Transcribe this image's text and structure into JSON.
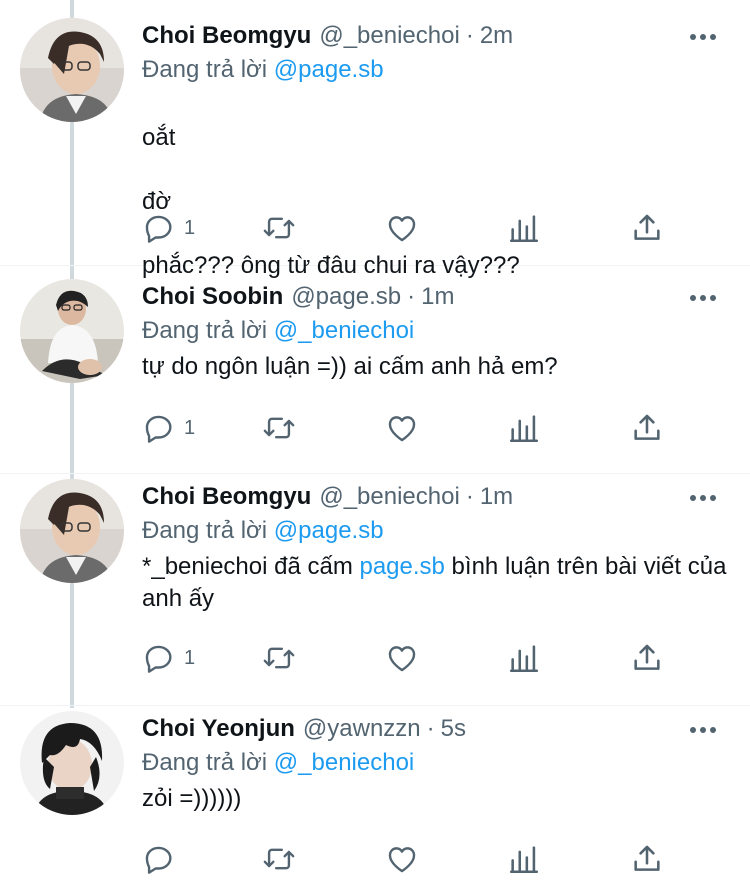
{
  "thread": {
    "reply_prefix": "Đang trả lời",
    "colors": {
      "text": "#0f1419",
      "secondary": "#536471",
      "link": "#1d9bf0",
      "thread_line": "#cfd9de"
    },
    "tweets": [
      {
        "name": "Choi Beomgyu",
        "handle": "@_beniechoi",
        "separator": "·",
        "time": "2m",
        "reply_to": "@page.sb",
        "text_lines": [
          "oắt",
          "đờ",
          "phắc??? ông từ đâu chui ra vậy???"
        ],
        "reply_count": "1",
        "avatar_icon": "avatar-photo"
      },
      {
        "name": "Choi Soobin",
        "handle": "@page.sb",
        "separator": "·",
        "time": "1m",
        "reply_to": "@_beniechoi",
        "text": "tự do ngôn luận =)) ai cấm anh hả em?",
        "reply_count": "1",
        "avatar_icon": "avatar-photo"
      },
      {
        "name": "Choi Beomgyu",
        "handle": "@_beniechoi",
        "separator": "·",
        "time": "1m",
        "reply_to": "@page.sb",
        "text_before": "*_beniechoi đã cấm ",
        "text_mention": "page.sb",
        "text_after": " bình luận trên bài viết của anh ấy",
        "reply_count": "1",
        "avatar_icon": "avatar-photo"
      },
      {
        "name": "Choi Yeonjun",
        "handle": "@yawnzzn",
        "separator": "·",
        "time": "5s",
        "reply_to": "@_beniechoi",
        "text": "zỏi =))))))",
        "reply_count": "",
        "avatar_icon": "avatar-photo"
      }
    ],
    "icons": {
      "more": "more-horizontal-icon",
      "reply": "reply-bubble-icon",
      "retweet": "retweet-icon",
      "like": "heart-icon",
      "views": "analytics-bars-icon",
      "share": "share-upload-icon"
    }
  }
}
